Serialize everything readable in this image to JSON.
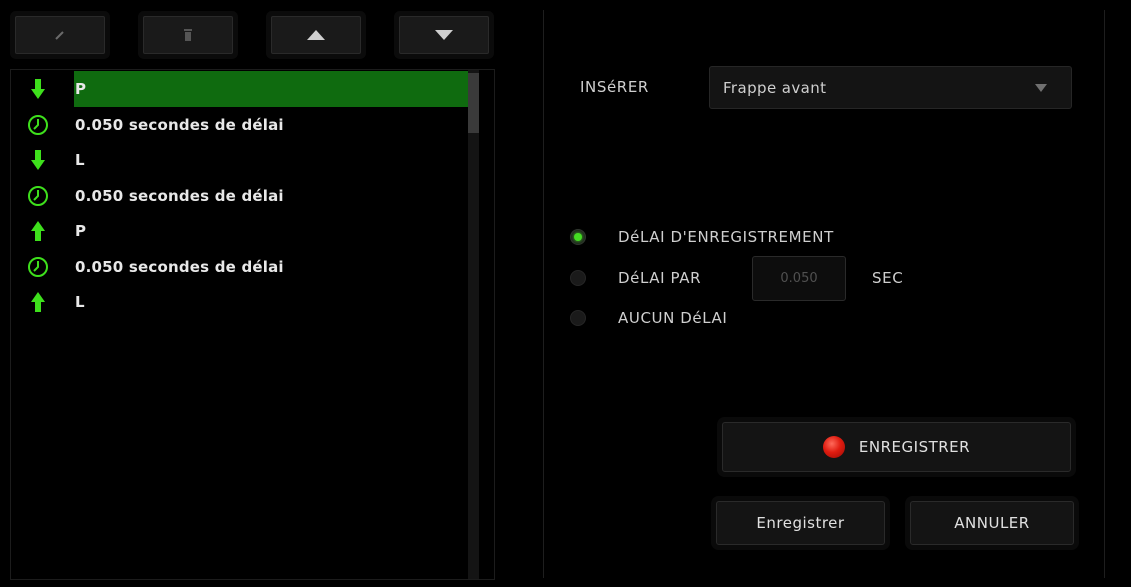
{
  "toolbar": {
    "icons": [
      "pencil-icon",
      "trash-icon",
      "arrow-up-icon",
      "arrow-down-icon"
    ]
  },
  "macro_list": {
    "items": [
      {
        "icon": "arrow-down-icon",
        "text": "P",
        "selected": true
      },
      {
        "icon": "clock-icon",
        "text": "0.050 secondes de délai",
        "selected": false
      },
      {
        "icon": "arrow-down-icon",
        "text": "L",
        "selected": false
      },
      {
        "icon": "clock-icon",
        "text": "0.050 secondes de délai",
        "selected": false
      },
      {
        "icon": "arrow-up-icon",
        "text": "P",
        "selected": false
      },
      {
        "icon": "clock-icon",
        "text": "0.050 secondes de délai",
        "selected": false
      },
      {
        "icon": "arrow-up-icon",
        "text": "L",
        "selected": false
      }
    ]
  },
  "settings": {
    "insert_label": "INSéRER",
    "insert_value": "Frappe avant",
    "delay_options": {
      "record": "DéLAI D'ENREGISTREMENT",
      "per": "DéLAI PAR",
      "none": "AUCUN DéLAI"
    },
    "selected_option": "record",
    "delay_value": "0.050",
    "sec_label": "SEC"
  },
  "buttons": {
    "record": "ENREGISTRER",
    "save": "Enregistrer",
    "cancel": "ANNULER"
  },
  "colors": {
    "accent_green": "#44dd22",
    "selected_row": "#0f6b0f",
    "record_red": "#e01c10"
  }
}
